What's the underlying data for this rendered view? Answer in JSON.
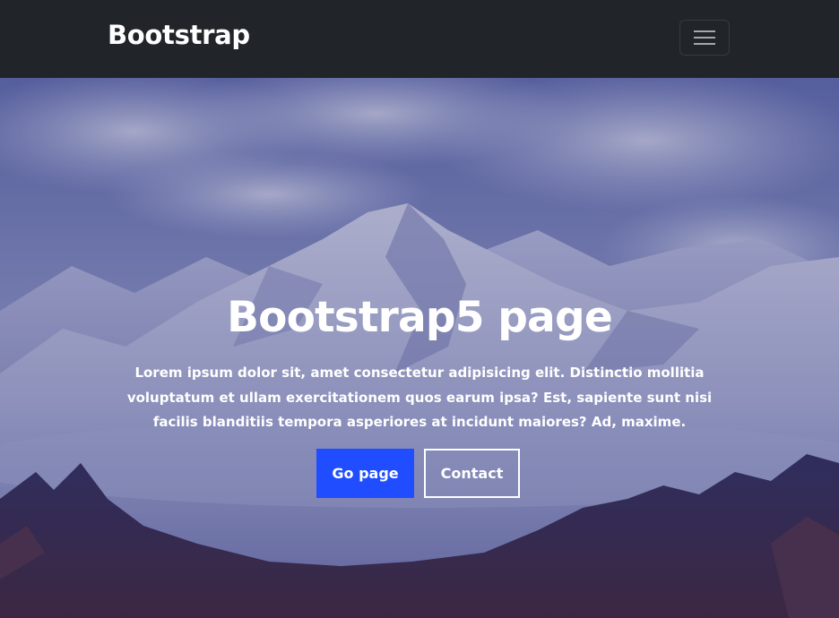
{
  "navbar": {
    "brand": "Bootstrap",
    "toggler_icon": "hamburger-menu-icon"
  },
  "hero": {
    "background": "snowy-mountain-photo",
    "title": "Bootstrap5 page",
    "text": "Lorem ipsum dolor sit, amet consectetur adipisicing elit. Distinctio mollitia voluptatum et ullam exercitationem quos earum ipsa? Est, sapiente sunt nisi facilis blanditiis tempora asperiores at incidunt maiores? Ad, maxime.",
    "primary_button": "Go page",
    "secondary_button": "Contact"
  },
  "colors": {
    "navbar_bg": "#212529",
    "primary": "#1f4dff",
    "text": "#ffffff"
  }
}
